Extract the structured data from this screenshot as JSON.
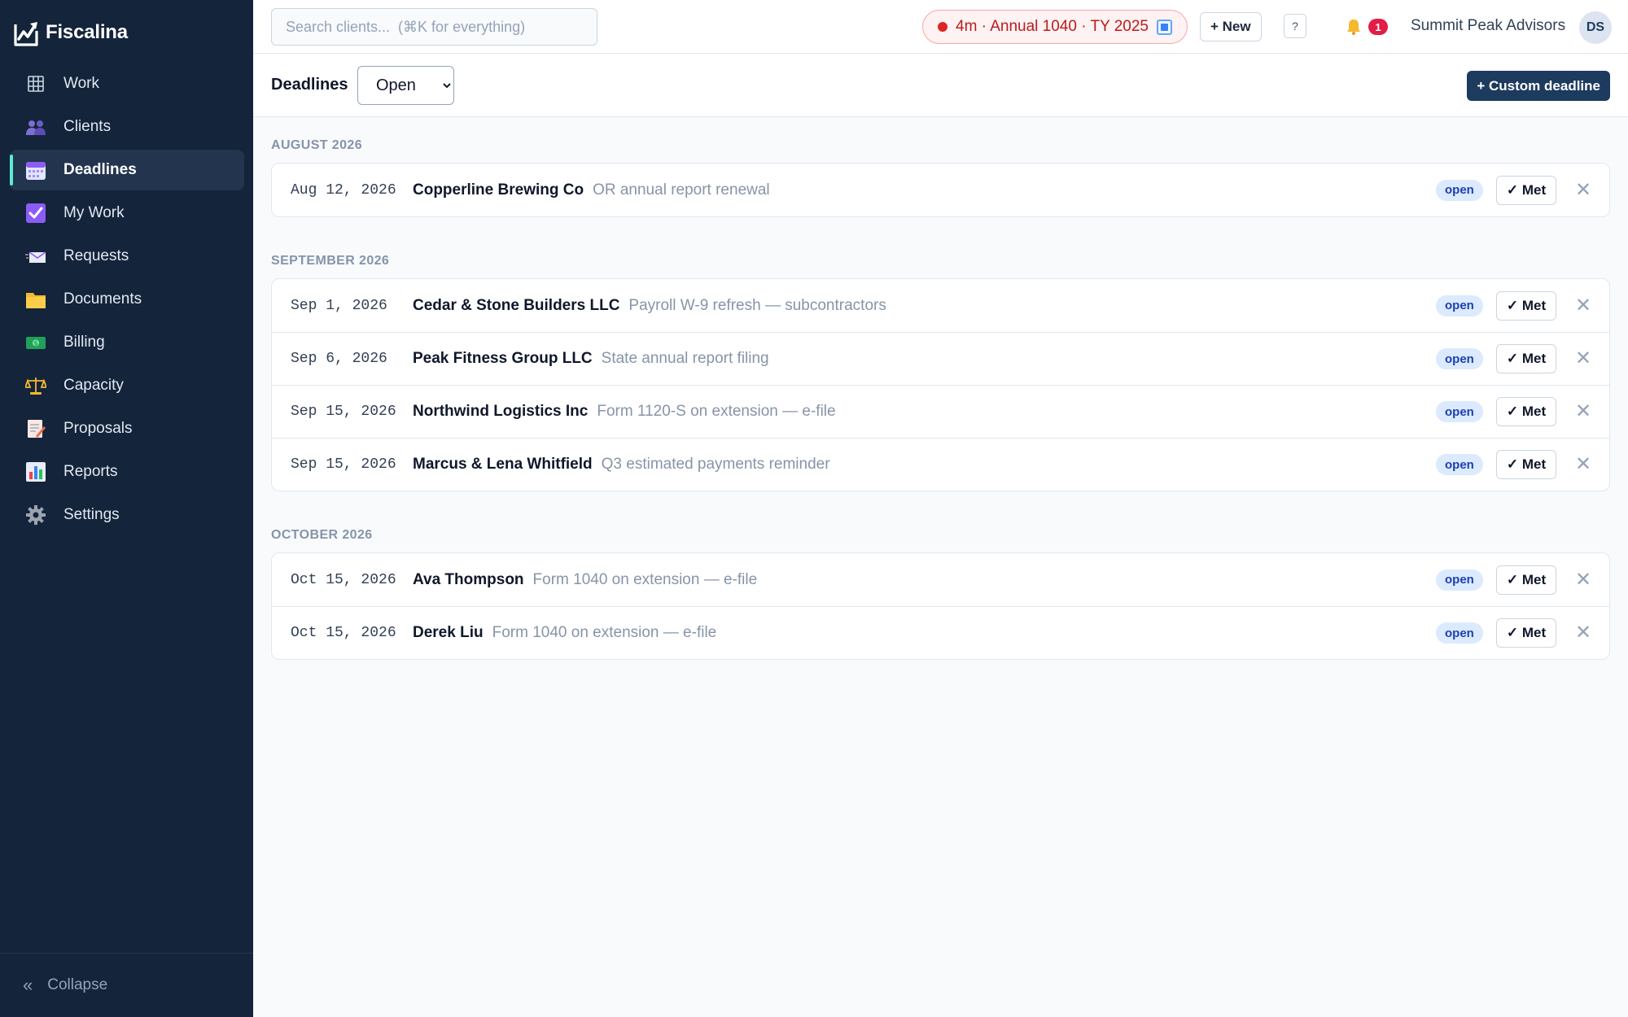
{
  "app": {
    "name": "Fiscalina"
  },
  "sidebar": {
    "items": [
      {
        "label": "Work",
        "icon": "grid-icon"
      },
      {
        "label": "Clients",
        "icon": "people-icon"
      },
      {
        "label": "Deadlines",
        "icon": "calendar-icon",
        "active": true
      },
      {
        "label": "My Work",
        "icon": "checkbox-icon"
      },
      {
        "label": "Requests",
        "icon": "envelope-icon"
      },
      {
        "label": "Documents",
        "icon": "folder-icon"
      },
      {
        "label": "Billing",
        "icon": "money-icon"
      },
      {
        "label": "Capacity",
        "icon": "scales-icon"
      },
      {
        "label": "Proposals",
        "icon": "memo-icon"
      },
      {
        "label": "Reports",
        "icon": "bar-chart-icon"
      },
      {
        "label": "Settings",
        "icon": "gear-icon"
      }
    ],
    "collapse_label": "Collapse"
  },
  "topbar": {
    "search_placeholder": "Search clients...  (⌘K for everything)",
    "timer_text": "4m · Annual 1040 · TY 2025",
    "new_label": "+ New",
    "help_label": "?",
    "notification_count": "1",
    "firm_name": "Summit Peak Advisors",
    "avatar_initials": "DS"
  },
  "page": {
    "title": "Deadlines",
    "filter_selected": "Open",
    "filter_options": [
      "Open"
    ],
    "custom_button": "+ Custom deadline"
  },
  "groups": [
    {
      "label": "AUGUST 2026",
      "rows": [
        {
          "date": "Aug 12, 2026",
          "client": "Copperline Brewing Co",
          "task": "OR annual report renewal",
          "status": "open",
          "met_label": "✓ Met",
          "dismiss": "✕"
        }
      ]
    },
    {
      "label": "SEPTEMBER 2026",
      "rows": [
        {
          "date": "Sep 1, 2026",
          "client": "Cedar & Stone Builders LLC",
          "task": "Payroll W-9 refresh — subcontractors",
          "status": "open",
          "met_label": "✓ Met",
          "dismiss": "✕"
        },
        {
          "date": "Sep 6, 2026",
          "client": "Peak Fitness Group LLC",
          "task": "State annual report filing",
          "status": "open",
          "met_label": "✓ Met",
          "dismiss": "✕"
        },
        {
          "date": "Sep 15, 2026",
          "client": "Northwind Logistics Inc",
          "task": "Form 1120-S on extension — e-file",
          "status": "open",
          "met_label": "✓ Met",
          "dismiss": "✕"
        },
        {
          "date": "Sep 15, 2026",
          "client": "Marcus & Lena Whitfield",
          "task": "Q3 estimated payments reminder",
          "status": "open",
          "met_label": "✓ Met",
          "dismiss": "✕"
        }
      ]
    },
    {
      "label": "OCTOBER 2026",
      "rows": [
        {
          "date": "Oct 15, 2026",
          "client": "Ava Thompson",
          "task": "Form 1040 on extension — e-file",
          "status": "open",
          "met_label": "✓ Met",
          "dismiss": "✕"
        },
        {
          "date": "Oct 15, 2026",
          "client": "Derek Liu",
          "task": "Form 1040 on extension — e-file",
          "status": "open",
          "met_label": "✓ Met",
          "dismiss": "✕"
        }
      ]
    }
  ]
}
